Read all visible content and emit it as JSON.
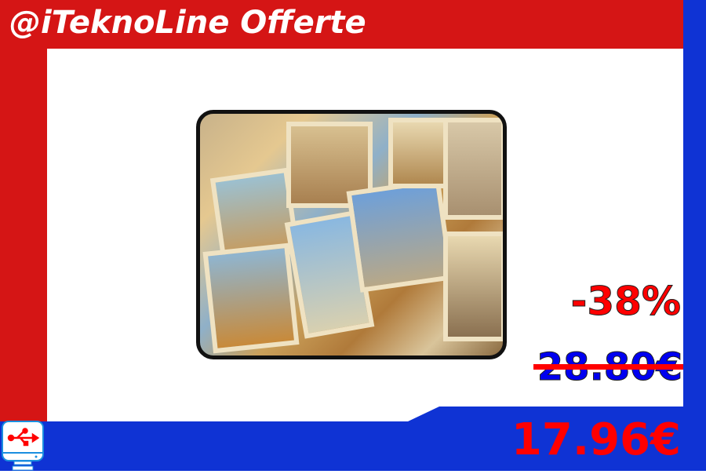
{
  "header": {
    "title": "@iTeknoLine Offerte"
  },
  "product": {
    "image": "laptop-sleeve-travel-collage"
  },
  "pricing": {
    "discount": "-38%",
    "old_price": "28.80€",
    "new_price": "17.96€"
  },
  "colors": {
    "red": "#d51515",
    "blue": "#0f33d4",
    "price_red": "#ff0000",
    "old_price_blue": "#0000f0"
  },
  "logo": {
    "icon": "usb-monitor-icon"
  }
}
